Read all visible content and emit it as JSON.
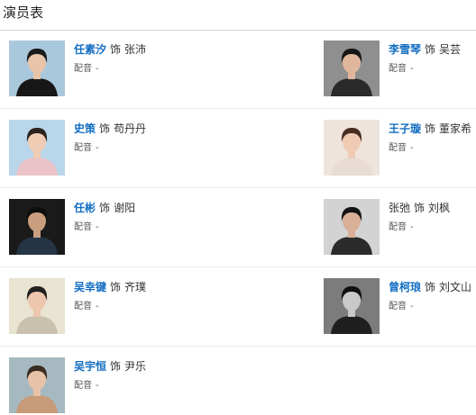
{
  "header": {
    "title": "演员表"
  },
  "cast": [
    {
      "actor": "任素汐",
      "sep": "饰",
      "role": "张沛",
      "dub_label": "配音",
      "dub_value": "-",
      "photo_icon": "actor-photo",
      "bg": "#aac8dc",
      "hair": "#1b1b1b",
      "skin": "#e8c4aa",
      "cloth": "#171717"
    },
    {
      "actor": "李雪琴",
      "sep": "饰",
      "role": "吴芸",
      "dub_label": "配音",
      "dub_value": "-",
      "photo_icon": "actor-photo",
      "bg": "#8f8f8f",
      "hair": "#161616",
      "skin": "#e0b79d",
      "cloth": "#2a2a2a"
    },
    {
      "actor": "史策",
      "sep": "饰",
      "role": "苟丹丹",
      "dub_label": "配音",
      "dub_value": "-",
      "photo_icon": "actor-photo",
      "bg": "#b9d6ea",
      "hair": "#2a221d",
      "skin": "#f0ccb5",
      "cloth": "#e9c3c8"
    },
    {
      "actor": "王子璇",
      "sep": "饰",
      "role": "董家希",
      "dub_label": "配音",
      "dub_value": "-",
      "photo_icon": "actor-photo",
      "bg": "#efe4dc",
      "hair": "#4a2e22",
      "skin": "#efcbb4",
      "cloth": "#e8dcd4"
    },
    {
      "actor": "任彬",
      "sep": "饰",
      "role": "谢阳",
      "dub_label": "配音",
      "dub_value": "-",
      "photo_icon": "actor-photo",
      "bg": "#1a1a1a",
      "hair": "#0d0d0d",
      "skin": "#c99e7f",
      "cloth": "#263546"
    },
    {
      "actor": "张弛",
      "sep": "饰",
      "role": "刘枫",
      "dub_label": "配音",
      "dub_value": "-",
      "photo_icon": "actor-photo",
      "bg": "#d3d3d3",
      "hair": "#141414",
      "skin": "#d8b097",
      "cloth": "#2b2b2b",
      "plain": true
    },
    {
      "actor": "吴幸键",
      "sep": "饰",
      "role": "齐璞",
      "dub_label": "配音",
      "dub_value": "-",
      "photo_icon": "actor-photo",
      "bg": "#e9e4d2",
      "hair": "#232020",
      "skin": "#ecc6ad",
      "cloth": "#c9c1ae"
    },
    {
      "actor": "曾柯琅",
      "sep": "饰",
      "role": "刘文山",
      "dub_label": "配音",
      "dub_value": "-",
      "photo_icon": "actor-photo",
      "bg": "#7c7c7c",
      "hair": "#101010",
      "skin": "#c9c9c9",
      "cloth": "#1f1f1f"
    },
    {
      "actor": "吴宇恒",
      "sep": "饰",
      "role": "尹乐",
      "dub_label": "配音",
      "dub_value": "-",
      "photo_icon": "actor-photo",
      "bg": "#a7b9c0",
      "hair": "#3a2c22",
      "skin": "#e6c2a8",
      "cloth": "#c79a78"
    }
  ]
}
